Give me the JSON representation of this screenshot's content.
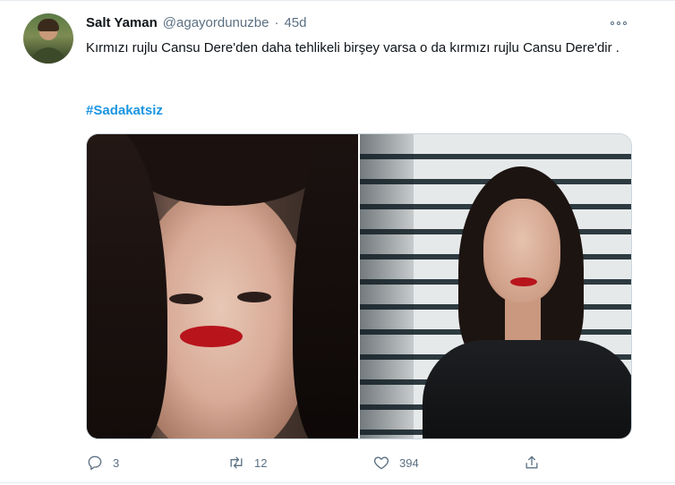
{
  "tweet": {
    "author_name": "Salt Yaman",
    "handle": "@agayordunuzbe",
    "separator": "·",
    "time": "45d",
    "text": "Kırmızı rujlu Cansu Dere'den daha tehlikeli birşey varsa o da kırmızı rujlu Cansu Dere'dir .",
    "hashtag": "#Sadakatsiz",
    "media_count": 2
  },
  "actions": {
    "reply_count": "3",
    "retweet_count": "12",
    "like_count": "394"
  },
  "icons": {
    "more": "more-horizontal-icon",
    "reply": "reply-icon",
    "retweet": "retweet-icon",
    "like": "heart-icon",
    "share": "share-icon"
  },
  "colors": {
    "hashtag": "#1b95e0",
    "secondary_text": "#5b7083",
    "border": "#ccd6dd"
  }
}
